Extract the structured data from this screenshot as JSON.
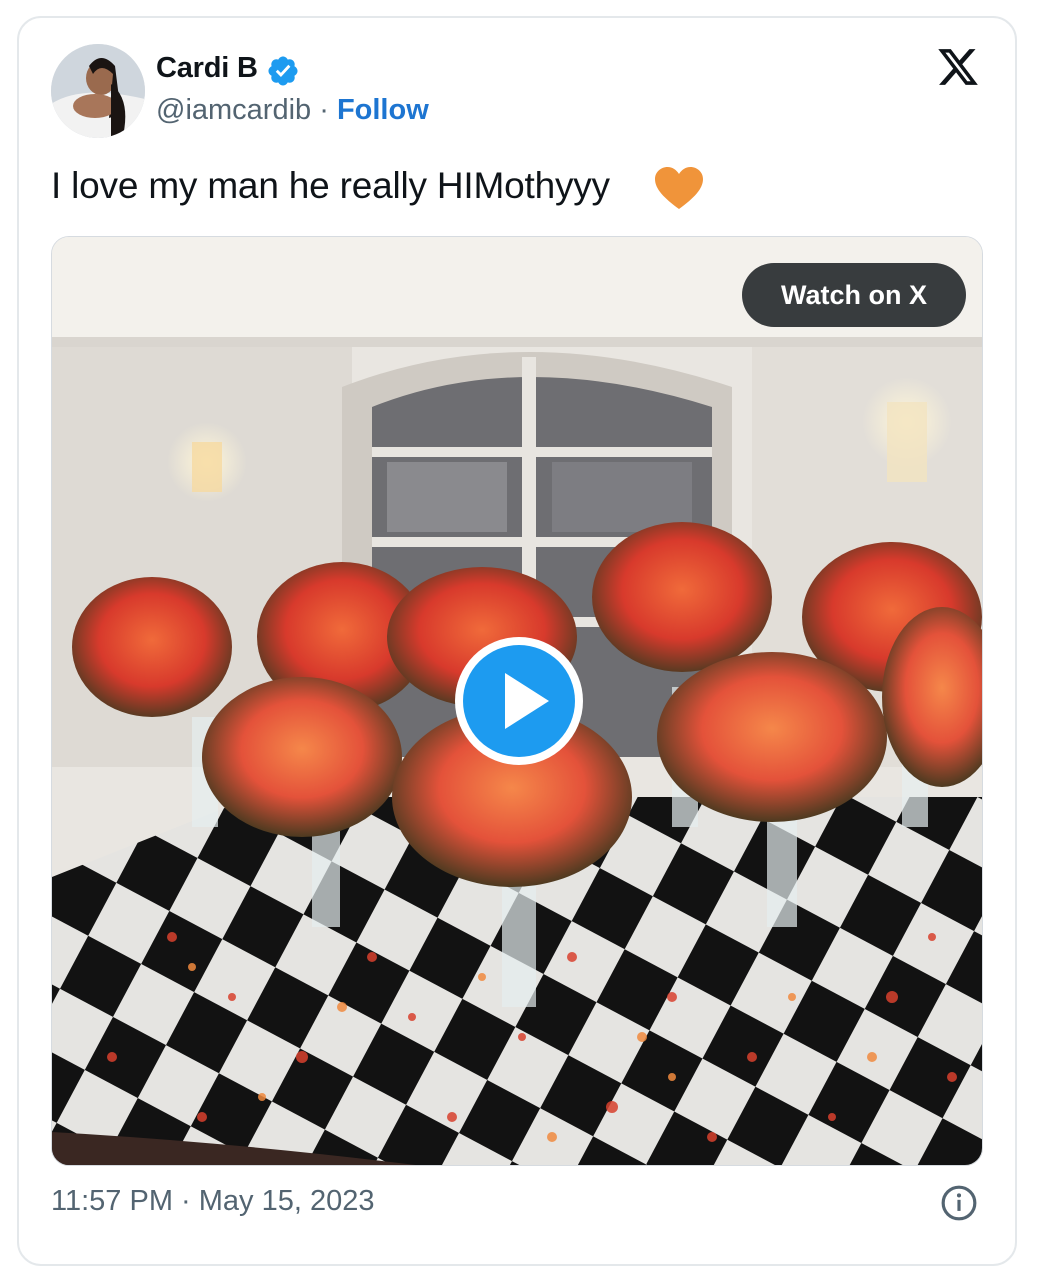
{
  "author": {
    "name": "Cardi B",
    "handle": "@iamcardib",
    "separator": " · ",
    "follow_label": "Follow",
    "verified": true,
    "avatar_icon": "profile-photo"
  },
  "tweet": {
    "text": "I love my man he really HIMothyyy",
    "emoji_icon": "orange-heart-icon"
  },
  "media": {
    "type": "video",
    "watch_label": "Watch on X",
    "play_icon": "play-icon",
    "scene": "entry hall filled with vases of red and orange roses on a black and white checkered floor"
  },
  "footer": {
    "timestamp": "11:57 PM · May 15, 2023",
    "info_icon": "info-icon"
  },
  "colors": {
    "text_primary": "#0f1419",
    "text_secondary": "#536471",
    "link": "#1d75d1",
    "verified_badge": "#1d9bf0",
    "play_button": "#1d9bf0",
    "heart": "#f0943a"
  }
}
